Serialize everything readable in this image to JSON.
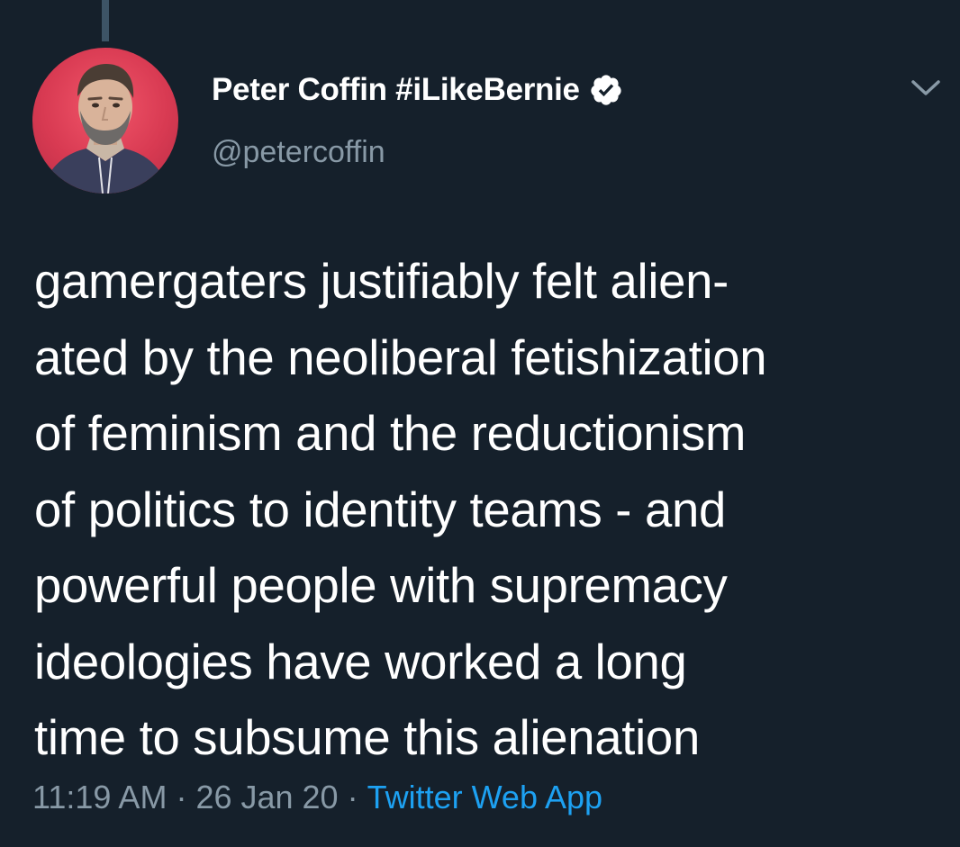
{
  "author": {
    "display_name": "Peter Coffin #iLikeBernie",
    "handle": "@petercoffin",
    "verified_icon": "verified-badge-icon",
    "avatar": "profile-photo"
  },
  "menu_icon": "chevron-down-icon",
  "tweet": {
    "text": "gamergaters justifiably felt alien-\nated by the neoliberal fetishization\nof feminism and the reductionism\nof politics to identity teams - and\npowerful people with supremacy\nideologies have worked a long\ntime to subsume this alienation"
  },
  "meta": {
    "time": "11:19 AM",
    "separator": "·",
    "date": "26 Jan 20",
    "source": "Twitter Web App"
  },
  "colors": {
    "background": "#15202b",
    "text_primary": "#ffffff",
    "text_secondary": "#8899a6",
    "link": "#1da1f2",
    "thread_line": "#3d5466"
  }
}
